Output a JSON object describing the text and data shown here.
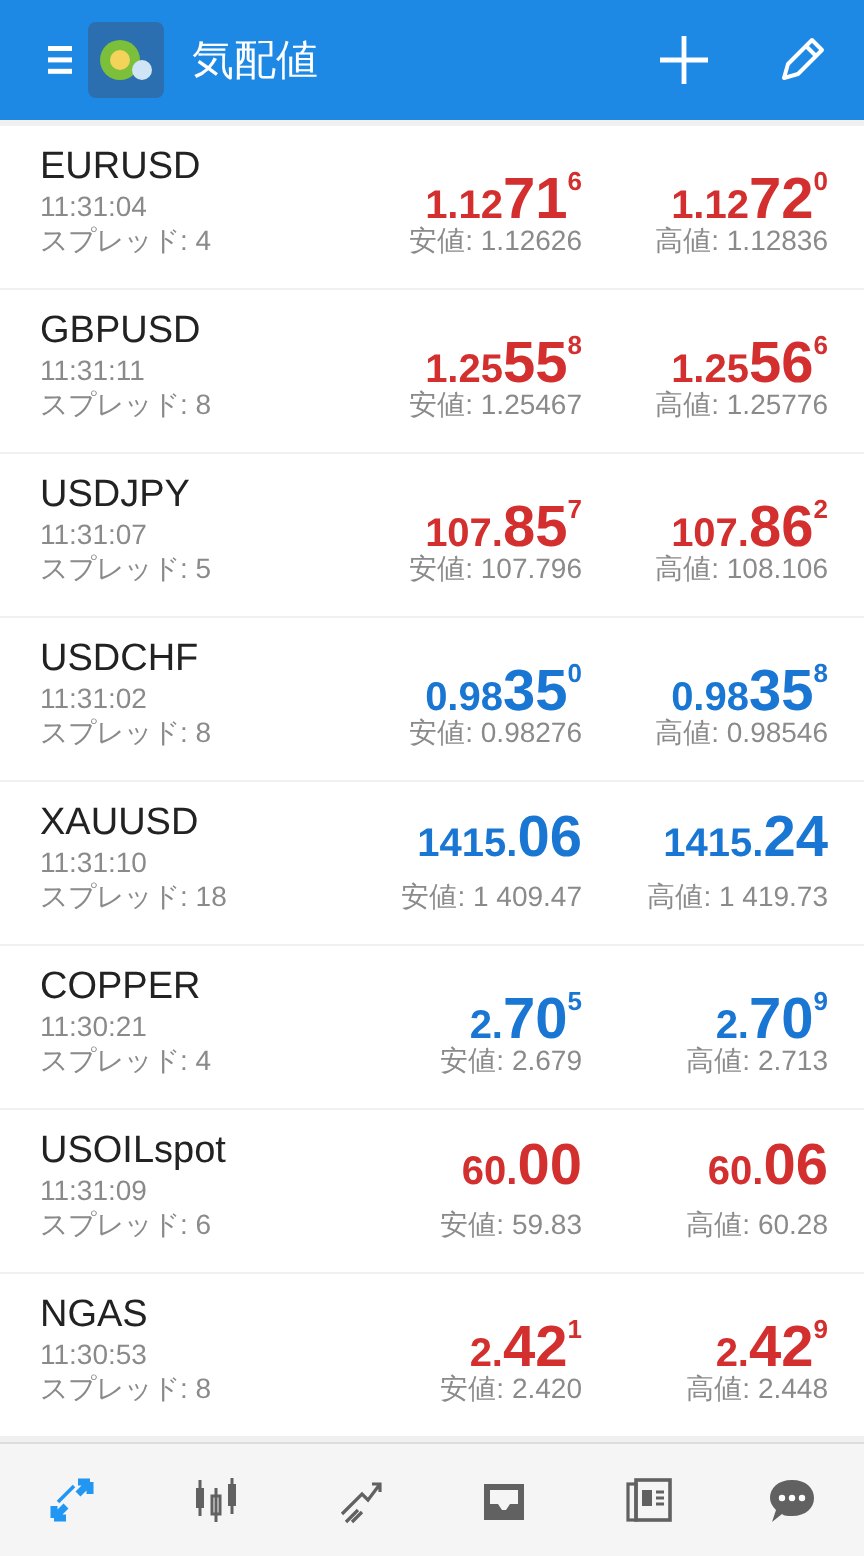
{
  "app_bar": {
    "title": "気配値"
  },
  "quotes": [
    {
      "symbol": "EURUSD",
      "time": "11:31:04",
      "spread": "スプレッド: 4",
      "color": "#d32f2f",
      "bid": {
        "prefix": "1.12",
        "big": "71",
        "sup": "6"
      },
      "ask": {
        "prefix": "1.12",
        "big": "72",
        "sup": "0"
      },
      "low": "安値: 1.12626",
      "high": "高値: 1.12836"
    },
    {
      "symbol": "GBPUSD",
      "time": "11:31:11",
      "spread": "スプレッド: 8",
      "color": "#d32f2f",
      "bid": {
        "prefix": "1.25",
        "big": "55",
        "sup": "8"
      },
      "ask": {
        "prefix": "1.25",
        "big": "56",
        "sup": "6"
      },
      "low": "安値: 1.25467",
      "high": "高値: 1.25776"
    },
    {
      "symbol": "USDJPY",
      "time": "11:31:07",
      "spread": "スプレッド: 5",
      "color": "#d32f2f",
      "bid": {
        "prefix": "107.",
        "big": "85",
        "sup": "7"
      },
      "ask": {
        "prefix": "107.",
        "big": "86",
        "sup": "2"
      },
      "low": "安値: 107.796",
      "high": "高値: 108.106"
    },
    {
      "symbol": "USDCHF",
      "time": "11:31:02",
      "spread": "スプレッド: 8",
      "color": "#1976d2",
      "bid": {
        "prefix": "0.98",
        "big": "35",
        "sup": "0"
      },
      "ask": {
        "prefix": "0.98",
        "big": "35",
        "sup": "8"
      },
      "low": "安値: 0.98276",
      "high": "高値: 0.98546"
    },
    {
      "symbol": "XAUUSD",
      "time": "11:31:10",
      "spread": "スプレッド: 18",
      "color": "#1976d2",
      "bid": {
        "prefix": "1415.",
        "big": "06"
      },
      "ask": {
        "prefix": "1415.",
        "big": "24"
      },
      "low": "安値: 1 409.47",
      "high": "高値: 1 419.73"
    },
    {
      "symbol": "COPPER",
      "time": "11:30:21",
      "spread": "スプレッド: 4",
      "color": "#1976d2",
      "bid": {
        "prefix": "2.",
        "big": "70",
        "sup": "5"
      },
      "ask": {
        "prefix": "2.",
        "big": "70",
        "sup": "9"
      },
      "low": "安値: 2.679",
      "high": "高値: 2.713"
    },
    {
      "symbol": "USOILspot",
      "time": "11:31:09",
      "spread": "スプレッド: 6",
      "color": "#d32f2f",
      "bid": {
        "prefix": "60.",
        "big": "00"
      },
      "ask": {
        "prefix": "60.",
        "big": "06"
      },
      "low": "安値: 59.83",
      "high": "高値: 60.28"
    },
    {
      "symbol": "NGAS",
      "time": "11:30:53",
      "spread": "スプレッド: 8",
      "color": "#d32f2f",
      "bid": {
        "prefix": "2.",
        "big": "42",
        "sup": "1"
      },
      "ask": {
        "prefix": "2.",
        "big": "42",
        "sup": "9"
      },
      "low": "安値: 2.420",
      "high": "高値: 2.448"
    }
  ],
  "nav": [
    {
      "kind": "quotes",
      "selected": true
    },
    {
      "kind": "chart",
      "selected": false
    },
    {
      "kind": "trade",
      "selected": false
    },
    {
      "kind": "inbox",
      "selected": false
    },
    {
      "kind": "news",
      "selected": false
    },
    {
      "kind": "chat",
      "selected": false
    }
  ]
}
